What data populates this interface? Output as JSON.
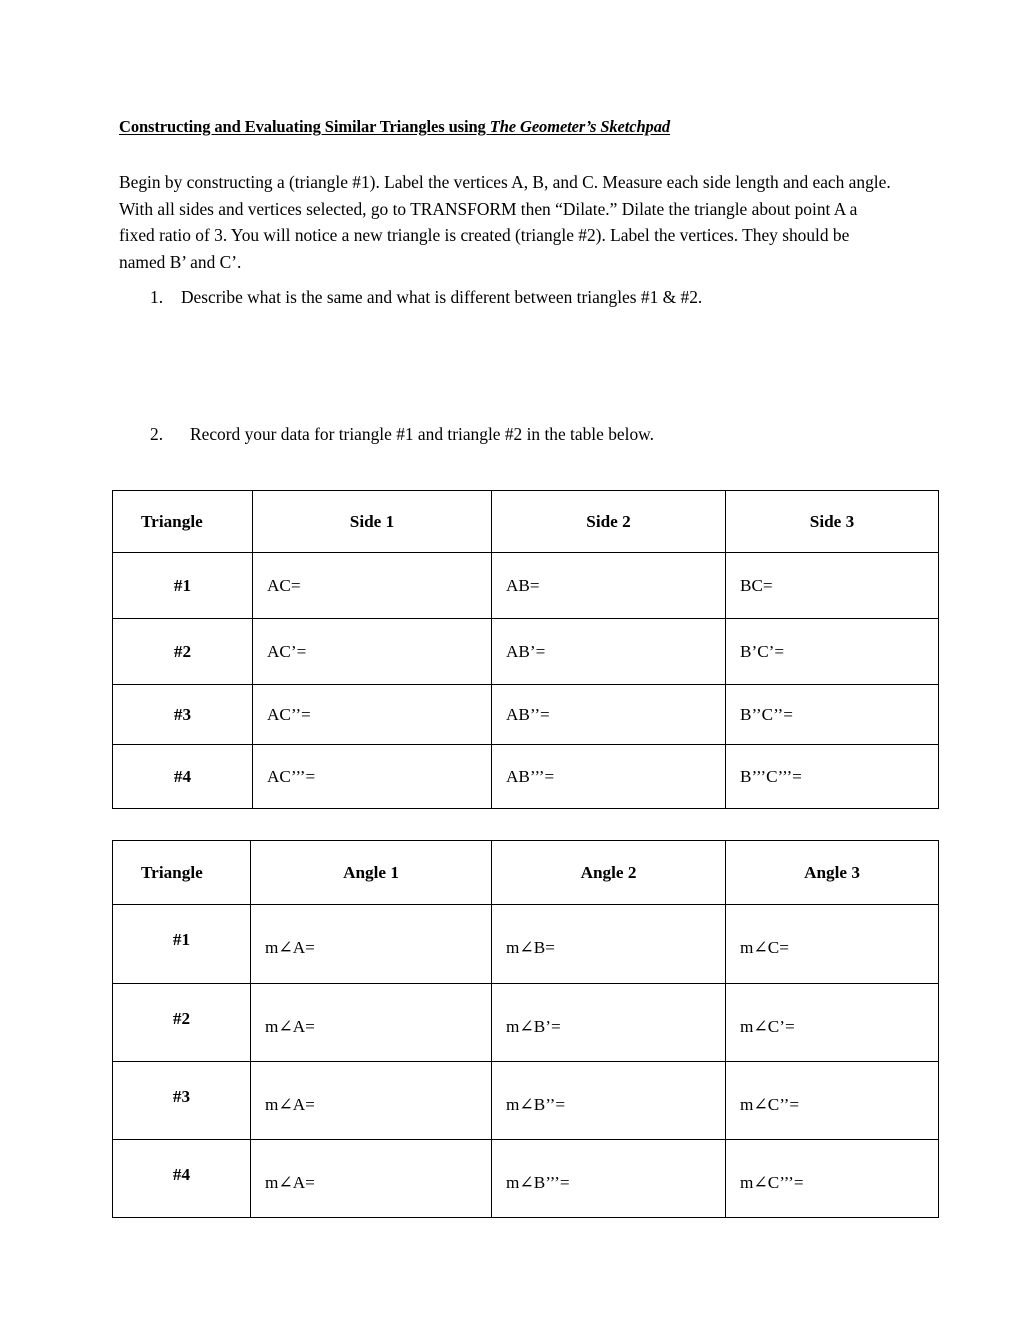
{
  "document": {
    "title_plain": "Constructing and Evaluating Similar Triangles using ",
    "title_italic": "The Geometer’s Sketchpad",
    "intro_paragraph": "Begin by constructing a (triangle #1). Label the vertices A, B, and C. Measure each side length and each angle. With all sides and vertices selected, go to TRANSFORM then “Dilate.” Dilate the triangle about point A a fixed ratio of 3. You will notice a new triangle is created (triangle #2). Label the vertices. They should be named B’ and C’.",
    "questions": [
      {
        "number": "1.",
        "text": "Describe what is the same and what is different between triangles #1 & #2."
      },
      {
        "number": "2.",
        "text": "Record your data for triangle #1 and triangle #2 in the table below."
      }
    ]
  },
  "table_sides": {
    "headers": [
      "Triangle",
      "Side 1",
      "Side 2",
      "Side 3"
    ],
    "rows": [
      {
        "label": "#1",
        "cells": [
          "AC=",
          "AB=",
          "BC="
        ]
      },
      {
        "label": "#2",
        "cells": [
          "AC’=",
          "AB’=",
          "B’C’="
        ]
      },
      {
        "label": "#3",
        "cells": [
          "AC’’=",
          "AB’’=",
          "B’’C’’="
        ]
      },
      {
        "label": "#4",
        "cells": [
          "AC’’’=",
          "AB’’’=",
          "B’’’C’’’="
        ]
      }
    ]
  },
  "table_angles": {
    "headers": [
      "Triangle",
      "Angle 1",
      "Angle 2",
      "Angle 3"
    ],
    "rows": [
      {
        "label": "#1",
        "cells": [
          "m∠A=",
          "m∠B=",
          "m∠C="
        ]
      },
      {
        "label": "#2",
        "cells": [
          "m∠A=",
          "m∠B’=",
          "m∠C’="
        ]
      },
      {
        "label": "#3",
        "cells": [
          "m∠A=",
          "m∠B’’=",
          "m∠C’’="
        ]
      },
      {
        "label": "#4",
        "cells": [
          "m∠A=",
          "m∠B’’’=",
          "m∠C’’’="
        ]
      }
    ]
  },
  "colors": {
    "page_background": "#ffffff",
    "text": "#000000",
    "table_border": "#000000"
  }
}
